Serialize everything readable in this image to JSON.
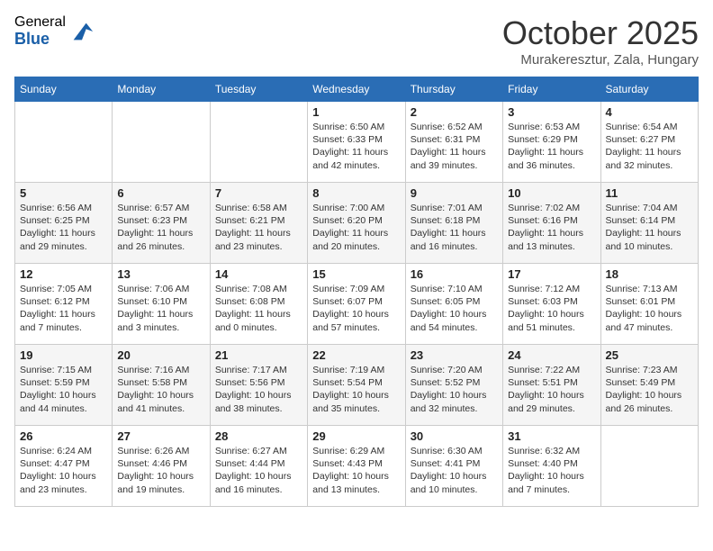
{
  "header": {
    "logo_general": "General",
    "logo_blue": "Blue",
    "month": "October 2025",
    "location": "Murakeresztur, Zala, Hungary"
  },
  "weekdays": [
    "Sunday",
    "Monday",
    "Tuesday",
    "Wednesday",
    "Thursday",
    "Friday",
    "Saturday"
  ],
  "weeks": [
    [
      {
        "day": "",
        "sunrise": "",
        "sunset": "",
        "daylight": ""
      },
      {
        "day": "",
        "sunrise": "",
        "sunset": "",
        "daylight": ""
      },
      {
        "day": "",
        "sunrise": "",
        "sunset": "",
        "daylight": ""
      },
      {
        "day": "1",
        "sunrise": "Sunrise: 6:50 AM",
        "sunset": "Sunset: 6:33 PM",
        "daylight": "Daylight: 11 hours and 42 minutes."
      },
      {
        "day": "2",
        "sunrise": "Sunrise: 6:52 AM",
        "sunset": "Sunset: 6:31 PM",
        "daylight": "Daylight: 11 hours and 39 minutes."
      },
      {
        "day": "3",
        "sunrise": "Sunrise: 6:53 AM",
        "sunset": "Sunset: 6:29 PM",
        "daylight": "Daylight: 11 hours and 36 minutes."
      },
      {
        "day": "4",
        "sunrise": "Sunrise: 6:54 AM",
        "sunset": "Sunset: 6:27 PM",
        "daylight": "Daylight: 11 hours and 32 minutes."
      }
    ],
    [
      {
        "day": "5",
        "sunrise": "Sunrise: 6:56 AM",
        "sunset": "Sunset: 6:25 PM",
        "daylight": "Daylight: 11 hours and 29 minutes."
      },
      {
        "day": "6",
        "sunrise": "Sunrise: 6:57 AM",
        "sunset": "Sunset: 6:23 PM",
        "daylight": "Daylight: 11 hours and 26 minutes."
      },
      {
        "day": "7",
        "sunrise": "Sunrise: 6:58 AM",
        "sunset": "Sunset: 6:21 PM",
        "daylight": "Daylight: 11 hours and 23 minutes."
      },
      {
        "day": "8",
        "sunrise": "Sunrise: 7:00 AM",
        "sunset": "Sunset: 6:20 PM",
        "daylight": "Daylight: 11 hours and 20 minutes."
      },
      {
        "day": "9",
        "sunrise": "Sunrise: 7:01 AM",
        "sunset": "Sunset: 6:18 PM",
        "daylight": "Daylight: 11 hours and 16 minutes."
      },
      {
        "day": "10",
        "sunrise": "Sunrise: 7:02 AM",
        "sunset": "Sunset: 6:16 PM",
        "daylight": "Daylight: 11 hours and 13 minutes."
      },
      {
        "day": "11",
        "sunrise": "Sunrise: 7:04 AM",
        "sunset": "Sunset: 6:14 PM",
        "daylight": "Daylight: 11 hours and 10 minutes."
      }
    ],
    [
      {
        "day": "12",
        "sunrise": "Sunrise: 7:05 AM",
        "sunset": "Sunset: 6:12 PM",
        "daylight": "Daylight: 11 hours and 7 minutes."
      },
      {
        "day": "13",
        "sunrise": "Sunrise: 7:06 AM",
        "sunset": "Sunset: 6:10 PM",
        "daylight": "Daylight: 11 hours and 3 minutes."
      },
      {
        "day": "14",
        "sunrise": "Sunrise: 7:08 AM",
        "sunset": "Sunset: 6:08 PM",
        "daylight": "Daylight: 11 hours and 0 minutes."
      },
      {
        "day": "15",
        "sunrise": "Sunrise: 7:09 AM",
        "sunset": "Sunset: 6:07 PM",
        "daylight": "Daylight: 10 hours and 57 minutes."
      },
      {
        "day": "16",
        "sunrise": "Sunrise: 7:10 AM",
        "sunset": "Sunset: 6:05 PM",
        "daylight": "Daylight: 10 hours and 54 minutes."
      },
      {
        "day": "17",
        "sunrise": "Sunrise: 7:12 AM",
        "sunset": "Sunset: 6:03 PM",
        "daylight": "Daylight: 10 hours and 51 minutes."
      },
      {
        "day": "18",
        "sunrise": "Sunrise: 7:13 AM",
        "sunset": "Sunset: 6:01 PM",
        "daylight": "Daylight: 10 hours and 47 minutes."
      }
    ],
    [
      {
        "day": "19",
        "sunrise": "Sunrise: 7:15 AM",
        "sunset": "Sunset: 5:59 PM",
        "daylight": "Daylight: 10 hours and 44 minutes."
      },
      {
        "day": "20",
        "sunrise": "Sunrise: 7:16 AM",
        "sunset": "Sunset: 5:58 PM",
        "daylight": "Daylight: 10 hours and 41 minutes."
      },
      {
        "day": "21",
        "sunrise": "Sunrise: 7:17 AM",
        "sunset": "Sunset: 5:56 PM",
        "daylight": "Daylight: 10 hours and 38 minutes."
      },
      {
        "day": "22",
        "sunrise": "Sunrise: 7:19 AM",
        "sunset": "Sunset: 5:54 PM",
        "daylight": "Daylight: 10 hours and 35 minutes."
      },
      {
        "day": "23",
        "sunrise": "Sunrise: 7:20 AM",
        "sunset": "Sunset: 5:52 PM",
        "daylight": "Daylight: 10 hours and 32 minutes."
      },
      {
        "day": "24",
        "sunrise": "Sunrise: 7:22 AM",
        "sunset": "Sunset: 5:51 PM",
        "daylight": "Daylight: 10 hours and 29 minutes."
      },
      {
        "day": "25",
        "sunrise": "Sunrise: 7:23 AM",
        "sunset": "Sunset: 5:49 PM",
        "daylight": "Daylight: 10 hours and 26 minutes."
      }
    ],
    [
      {
        "day": "26",
        "sunrise": "Sunrise: 6:24 AM",
        "sunset": "Sunset: 4:47 PM",
        "daylight": "Daylight: 10 hours and 23 minutes."
      },
      {
        "day": "27",
        "sunrise": "Sunrise: 6:26 AM",
        "sunset": "Sunset: 4:46 PM",
        "daylight": "Daylight: 10 hours and 19 minutes."
      },
      {
        "day": "28",
        "sunrise": "Sunrise: 6:27 AM",
        "sunset": "Sunset: 4:44 PM",
        "daylight": "Daylight: 10 hours and 16 minutes."
      },
      {
        "day": "29",
        "sunrise": "Sunrise: 6:29 AM",
        "sunset": "Sunset: 4:43 PM",
        "daylight": "Daylight: 10 hours and 13 minutes."
      },
      {
        "day": "30",
        "sunrise": "Sunrise: 6:30 AM",
        "sunset": "Sunset: 4:41 PM",
        "daylight": "Daylight: 10 hours and 10 minutes."
      },
      {
        "day": "31",
        "sunrise": "Sunrise: 6:32 AM",
        "sunset": "Sunset: 4:40 PM",
        "daylight": "Daylight: 10 hours and 7 minutes."
      },
      {
        "day": "",
        "sunrise": "",
        "sunset": "",
        "daylight": ""
      }
    ]
  ]
}
